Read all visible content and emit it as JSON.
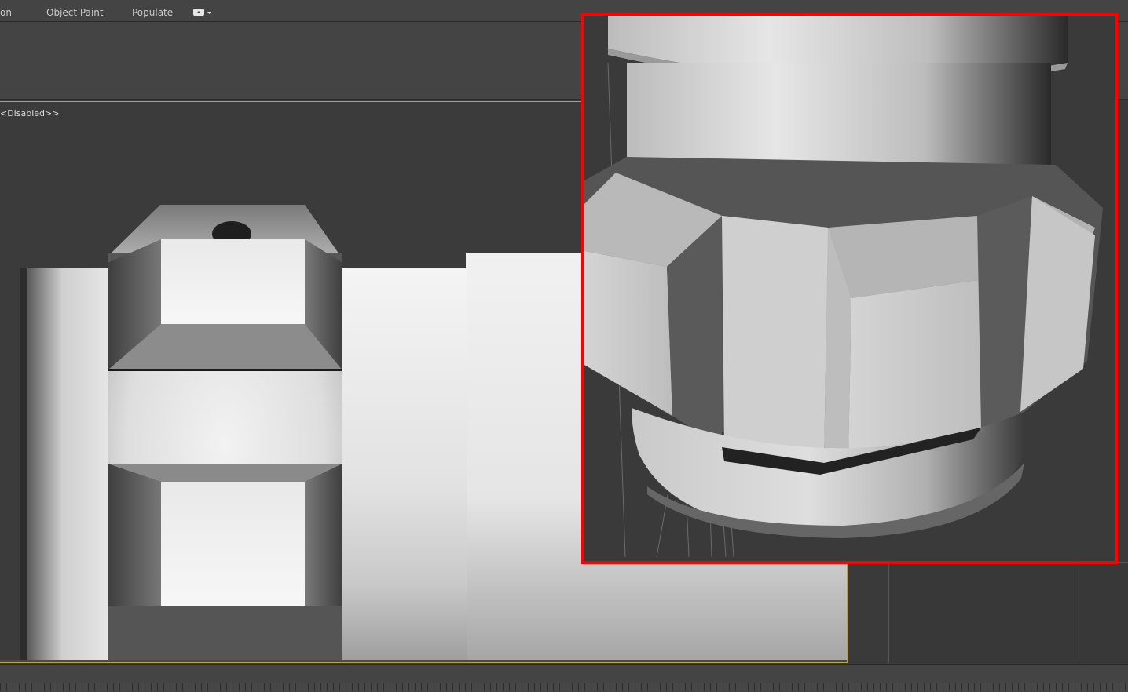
{
  "ribbon": {
    "tabs": [
      {
        "label": "on"
      },
      {
        "label": "Object Paint"
      },
      {
        "label": "Populate"
      }
    ]
  },
  "viewport": {
    "label": "<Disabled>>"
  },
  "icons": [
    "ribbon-dropdown-icon",
    "toolbar-strip-icon"
  ],
  "colors": {
    "ui_bg": "#3a3a3a",
    "viewport_border": "#b9a63a",
    "callout_frame": "#ff0000",
    "model_surface": "#d9d9d9"
  }
}
